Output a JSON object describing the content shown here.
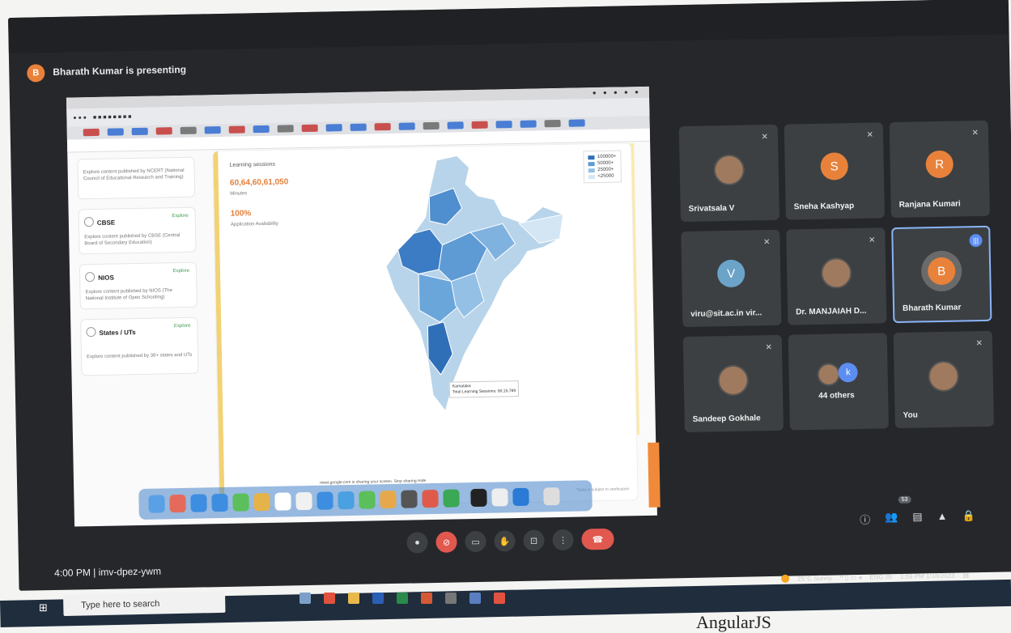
{
  "meet": {
    "presenter_initial": "B",
    "presenting_text": "Bharath Kumar is presenting",
    "time": "4:00 PM",
    "separator": "|",
    "meeting_code": "imv-dpez-ywm",
    "participant_count": "53"
  },
  "shared_screen": {
    "cards": [
      {
        "title": "",
        "desc": "Explore content published by NCERT (National Council of Educational Research and Training)",
        "badge": ""
      },
      {
        "title": "CBSE",
        "desc": "Explore content published by CBSE (Central Board of Secondary Education)",
        "badge": "Explore"
      },
      {
        "title": "NIOS",
        "desc": "Explore content published by NIOS (The National Institute of Open Schooling)",
        "badge": "Explore"
      },
      {
        "title": "States / UTs",
        "desc": "Explore content published by 36+ states and UTs",
        "badge": "Explore"
      }
    ],
    "map": {
      "stat_label": "Learning sessions",
      "stat1_value": "60,64,60,61,050",
      "stat1_sub": "Minutes",
      "stat2_value": "100%",
      "stat2_sub": "Application Availability",
      "legend": [
        "100000+",
        "50000+",
        "25000+",
        "<25000"
      ],
      "tooltip_title": "Karnataka",
      "tooltip_value": "Total Learning Sessions: 60,15,789",
      "footer": "*Data is subject to verification"
    },
    "share_toast": "meet.google.com is sharing your screen.   Stop sharing   Hide"
  },
  "participants": [
    {
      "name": "Srivatsala V",
      "initial": "",
      "color": "#a07a5e",
      "photo": true
    },
    {
      "name": "Sneha Kashyap",
      "initial": "S",
      "color": "#e8823a",
      "photo": false
    },
    {
      "name": "Ranjana Kumari",
      "initial": "R",
      "color": "#e8823a",
      "photo": false
    },
    {
      "name": "viru@sit.ac.in vir...",
      "initial": "V",
      "color": "#6ba3c9",
      "photo": false
    },
    {
      "name": "Dr. MANJAIAH D...",
      "initial": "",
      "color": "#a07a5e",
      "photo": true
    },
    {
      "name": "Bharath Kumar",
      "initial": "B",
      "color": "#e8823a",
      "photo": false
    },
    {
      "name": "Sandeep Gokhale",
      "initial": "",
      "color": "#a07a5e",
      "photo": true
    },
    {
      "name": "44 others",
      "initial": "k",
      "color": "#5c8df0",
      "photo": false
    },
    {
      "name": "You",
      "initial": "",
      "color": "#a07a5e",
      "photo": true
    }
  ],
  "taskbar": {
    "search_placeholder": "Type here to search",
    "weather": "25°C  Sunny",
    "lang": "ENG",
    "lang2": "IN",
    "clock_time": "3:59 PM",
    "clock_date": "1/18/2023"
  },
  "page_below": "AngularJS"
}
